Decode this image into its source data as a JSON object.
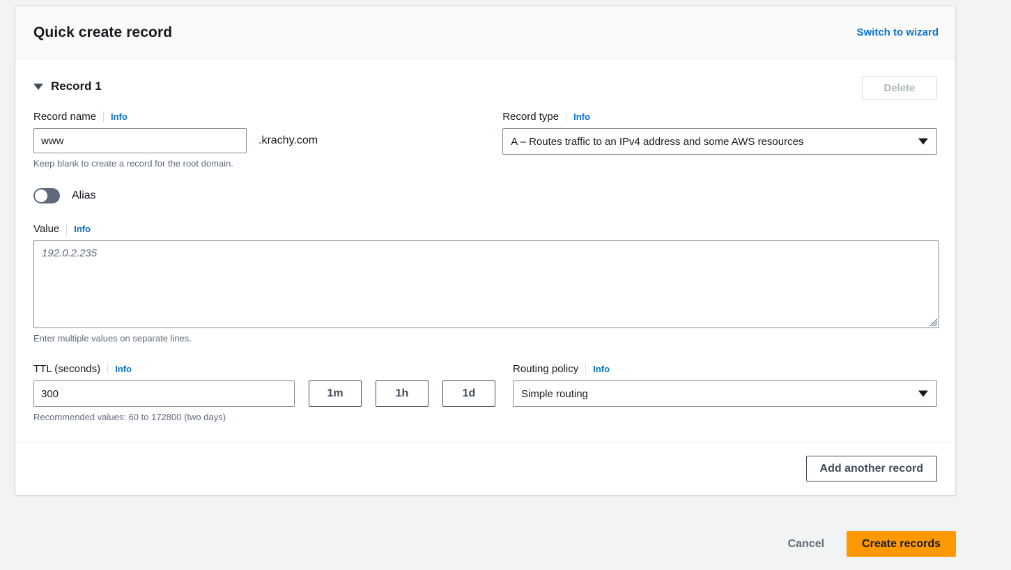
{
  "header": {
    "title": "Quick create record",
    "switch_link": "Switch to wizard"
  },
  "record": {
    "label": "Record 1",
    "delete_label": "Delete",
    "name": {
      "label": "Record name",
      "info": "Info",
      "value": "www",
      "suffix": ".krachy.com",
      "hint": "Keep blank to create a record for the root domain."
    },
    "type": {
      "label": "Record type",
      "info": "Info",
      "value": "A – Routes traffic to an IPv4 address and some AWS resources"
    },
    "alias": {
      "label": "Alias",
      "state": "off"
    },
    "value": {
      "label": "Value",
      "info": "Info",
      "placeholder": "192.0.2.235",
      "text": "",
      "hint": "Enter multiple values on separate lines."
    },
    "ttl": {
      "label": "TTL (seconds)",
      "info": "Info",
      "value": "300",
      "hint": "Recommended values: 60 to 172800 (two days)",
      "presets": [
        "1m",
        "1h",
        "1d"
      ]
    },
    "routing": {
      "label": "Routing policy",
      "info": "Info",
      "value": "Simple routing"
    }
  },
  "actions": {
    "add_another": "Add another record",
    "cancel": "Cancel",
    "create": "Create records"
  },
  "colors": {
    "link": "#0972d3",
    "primary": "#ff9900",
    "page_bg": "#f2f3f3",
    "toggle_off": "#5f6b7a"
  }
}
